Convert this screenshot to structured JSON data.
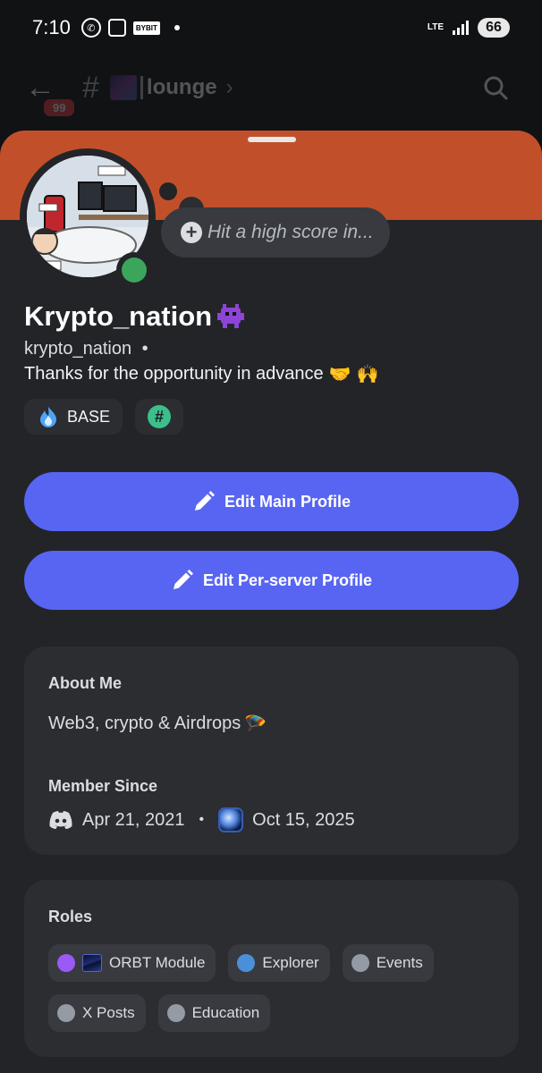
{
  "status_bar": {
    "time": "7:10",
    "bybit_label": "BYBIT",
    "network": "LTE",
    "battery": "66"
  },
  "channel_header": {
    "unread_badge": "99",
    "channel_name": "lounge"
  },
  "profile": {
    "status_placeholder": "Hit a high score in...",
    "display_name": "Krypto_nation",
    "username": "krypto_nation",
    "username_separator": "•",
    "bio": "Thanks for the opportunity in advance",
    "badges": [
      {
        "label": "BASE",
        "icon": "base-flame-icon"
      },
      {
        "label": "",
        "icon": "hash-icon"
      }
    ]
  },
  "buttons": {
    "edit_main": "Edit Main Profile",
    "edit_server": "Edit Per-server Profile"
  },
  "about": {
    "title": "About Me",
    "text": "Web3, crypto & Airdrops",
    "member_since_title": "Member Since",
    "discord_date": "Apr 21, 2021",
    "separator": "•",
    "server_date": "Oct 15, 2025"
  },
  "roles": {
    "title": "Roles",
    "items": [
      {
        "label": "ORBT Module",
        "color": "#9b59f6"
      },
      {
        "label": "Explorer",
        "color": "#4a90d9"
      },
      {
        "label": "Events",
        "color": "#949ba4"
      },
      {
        "label": "X Posts",
        "color": "#949ba4"
      },
      {
        "label": "Education",
        "color": "#949ba4"
      }
    ]
  },
  "colors": {
    "banner": "#c1502a",
    "accent": "#5865f2",
    "online": "#3ba55c"
  }
}
